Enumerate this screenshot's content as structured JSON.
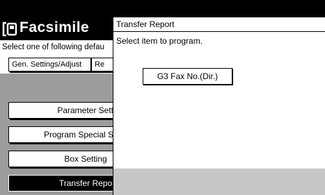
{
  "app": {
    "title": "Facsimile",
    "icon": "fax-icon"
  },
  "left": {
    "prompt": "Select one of following defau",
    "tabs": [
      {
        "label": "Gen. Settings/Adjust"
      },
      {
        "label": "Re"
      }
    ],
    "items": [
      {
        "label": "Parameter Setti"
      },
      {
        "label": "Program Special S"
      },
      {
        "label": "Box Setting"
      },
      {
        "label": "Transfer Repor",
        "selected": true
      }
    ]
  },
  "dialog": {
    "title": "Transfer Report",
    "instruction": "Select item to program.",
    "item_label": "G3 Fax No.(Dir.)"
  }
}
